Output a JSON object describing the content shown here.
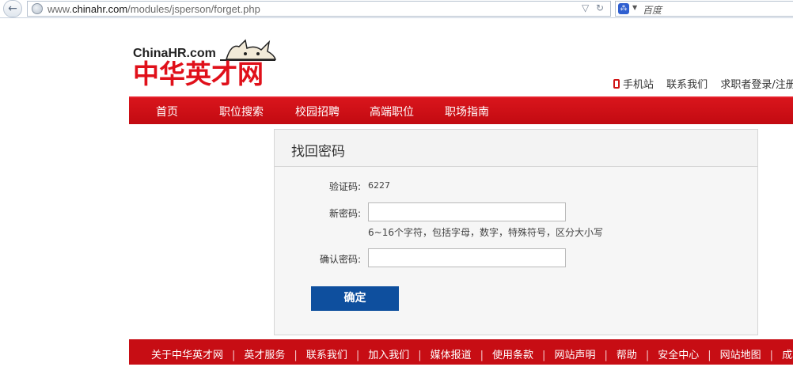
{
  "browser": {
    "back_glyph": "←",
    "url_prefix": "www.",
    "url_domain": "chinahr.com",
    "url_path": "/modules/jsperson/forget.php",
    "search_placeholder": "百度",
    "search_engine_glyph": "⁂"
  },
  "header": {
    "logo_en": "ChinaHR.com",
    "logo_cn": "中华英才网",
    "links": [
      {
        "label": "手机站"
      },
      {
        "label": "联系我们"
      },
      {
        "label": "求职者登录/注册"
      }
    ]
  },
  "nav": {
    "items": [
      {
        "label": "首页"
      },
      {
        "label": "职位搜索"
      },
      {
        "label": "校园招聘"
      },
      {
        "label": "高端职位"
      },
      {
        "label": "职场指南"
      }
    ]
  },
  "form": {
    "title": "找回密码",
    "captcha_label": "验证码:",
    "captcha_value": "6227",
    "new_password_label": "新密码:",
    "new_password_value": "",
    "password_hint": "6~16个字符，包括字母，数字，特殊符号，区分大小写",
    "confirm_password_label": "确认密码:",
    "confirm_password_value": "",
    "submit_label": "确定"
  },
  "footer": {
    "links": [
      {
        "label": "关于中华英才网"
      },
      {
        "label": "英才服务"
      },
      {
        "label": "联系我们"
      },
      {
        "label": "加入我们"
      },
      {
        "label": "媒体报道"
      },
      {
        "label": "使用条款"
      },
      {
        "label": "网站声明"
      },
      {
        "label": "帮助"
      },
      {
        "label": "安全中心"
      },
      {
        "label": "网站地图"
      },
      {
        "label": "成功招聘"
      }
    ],
    "separator": "|"
  },
  "colors": {
    "brand_red": "#d9151c",
    "button_blue": "#0e4f9e"
  }
}
